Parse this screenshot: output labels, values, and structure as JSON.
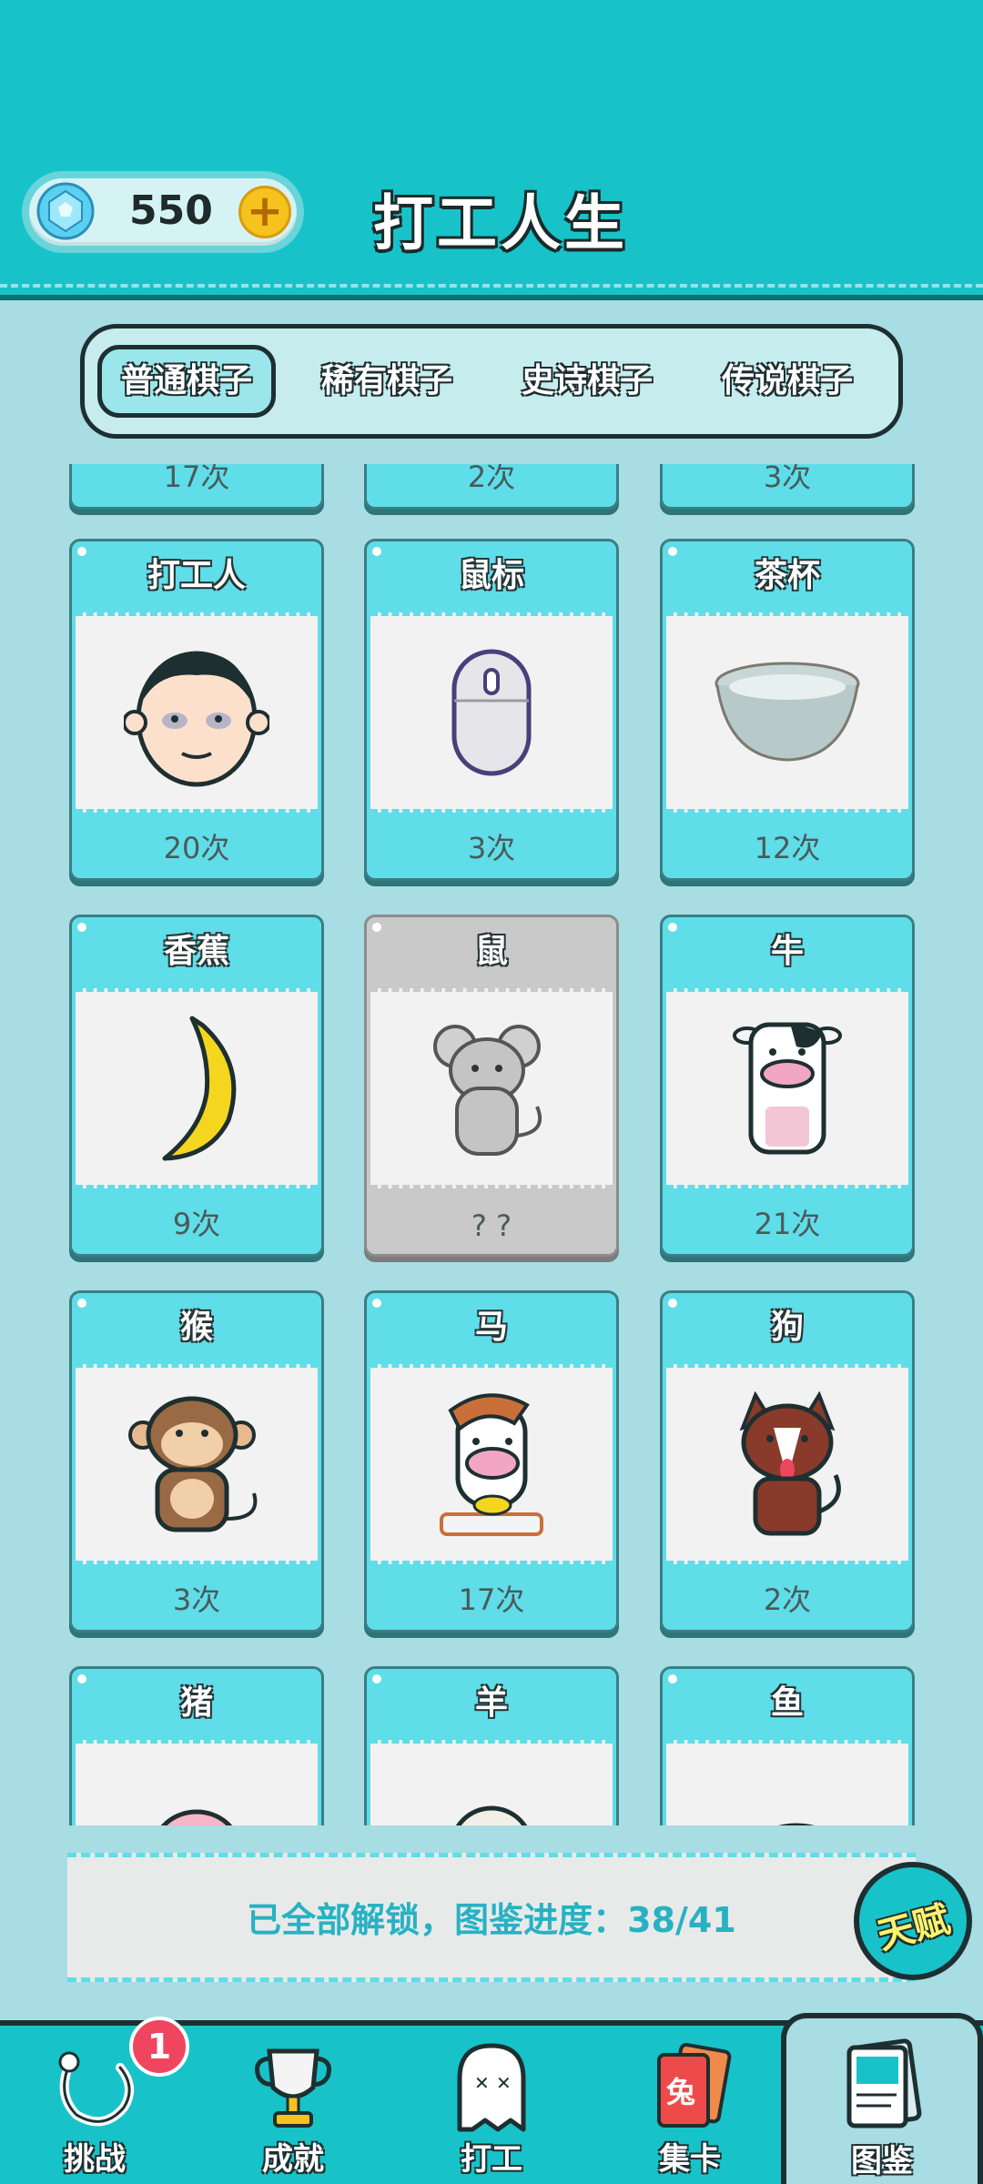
{
  "header": {
    "gems": "550",
    "plus": "+",
    "title": "打工人生"
  },
  "tabs": [
    {
      "label": "普通棋子",
      "active": true
    },
    {
      "label": "稀有棋子",
      "active": false
    },
    {
      "label": "史诗棋子",
      "active": false
    },
    {
      "label": "传说棋子",
      "active": false
    }
  ],
  "cards": [
    {
      "name": "",
      "count": "17次",
      "icon": "partial"
    },
    {
      "name": "",
      "count": "2次",
      "icon": "partial"
    },
    {
      "name": "",
      "count": "3次",
      "icon": "partial"
    },
    {
      "name": "打工人",
      "count": "20次",
      "icon": "worker-face-icon"
    },
    {
      "name": "鼠标",
      "count": "3次",
      "icon": "mouse-device-icon"
    },
    {
      "name": "茶杯",
      "count": "12次",
      "icon": "tea-bowl-icon"
    },
    {
      "name": "香蕉",
      "count": "9次",
      "icon": "banana-icon"
    },
    {
      "name": "鼠",
      "count": "? ?",
      "icon": "rat-icon",
      "locked": true
    },
    {
      "name": "牛",
      "count": "21次",
      "icon": "cow-icon"
    },
    {
      "name": "猴",
      "count": "3次",
      "icon": "monkey-icon"
    },
    {
      "name": "马",
      "count": "17次",
      "icon": "horse-icon"
    },
    {
      "name": "狗",
      "count": "2次",
      "icon": "dog-icon"
    },
    {
      "name": "猪",
      "count": "",
      "icon": "pig-icon"
    },
    {
      "name": "羊",
      "count": "",
      "icon": "sheep-icon"
    },
    {
      "name": "鱼",
      "count": "",
      "icon": "fish-icon"
    }
  ],
  "progress": {
    "text": "已全部解锁，图鉴进度：38/41",
    "talent_button": "天赋"
  },
  "bottom_nav": [
    {
      "label": "挑战",
      "badge": "1"
    },
    {
      "label": "成就"
    },
    {
      "label": "打工"
    },
    {
      "label": "集卡",
      "card_glyph": "兔"
    },
    {
      "label": "图鉴",
      "active": true
    }
  ],
  "colors": {
    "header": "#17c3c8",
    "card": "#5fdde8",
    "background": "#a7dde3",
    "badge": "#f0455f"
  }
}
